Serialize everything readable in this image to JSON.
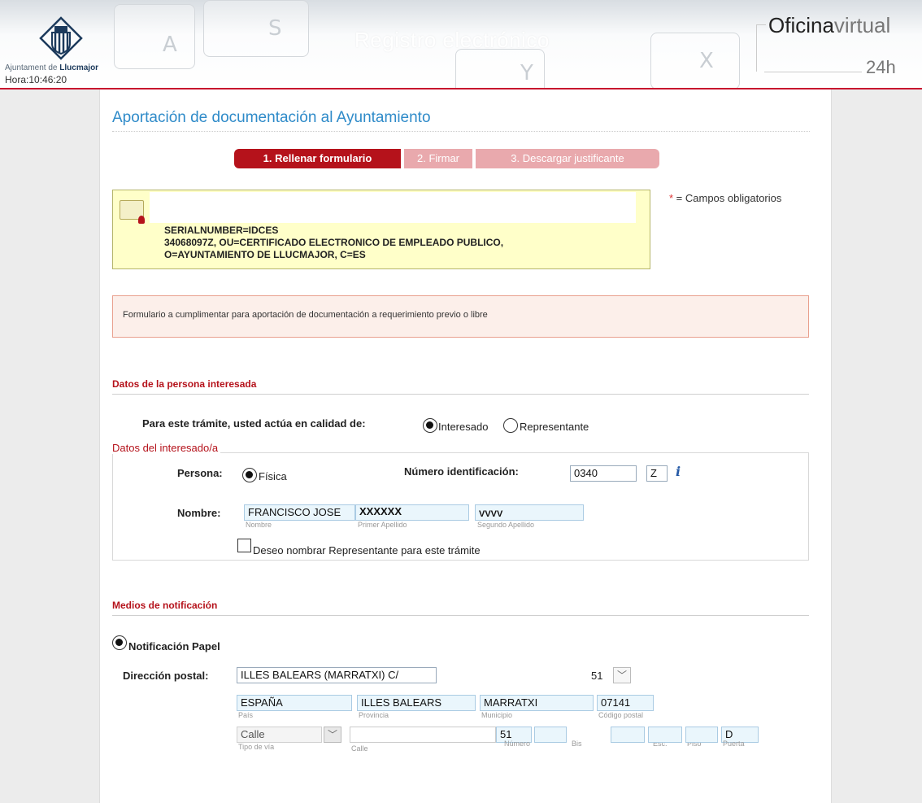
{
  "header": {
    "municipality_prefix": "Ajuntament de",
    "municipality_name": "Llucmajor",
    "clock": "Hora:10:46:20",
    "title": "Registro electrónico",
    "brand_main": "Oficina",
    "brand_suffix": "virtual",
    "brand_hours": "24h"
  },
  "page": {
    "title": "Aportación de documentación al Ayuntamiento",
    "steps": [
      "1. Rellenar formulario",
      "2. Firmar",
      "3. Descargar justificante"
    ],
    "required_star": "*",
    "required_note": " = Campos obligatorios",
    "certificate": {
      "line1": "SERIALNUMBER=IDCES",
      "line2": "34068097Z, OU=CERTIFICADO ELECTRONICO DE EMPLEADO PUBLICO,",
      "line3": "O=AYUNTAMIENTO DE LLUCMAJOR, C=ES"
    },
    "info_text": "Formulario a cumplimentar para aportación de documentación a requerimiento previo o libre"
  },
  "interesado": {
    "section_title": "Datos de la persona interesada",
    "role_question": "Para este trámite, usted actúa en calidad de:",
    "role_options": [
      "Interesado",
      "Representante"
    ],
    "fieldset_legend": "Datos del interesado/a",
    "persona_label": "Persona:",
    "persona_option": "Física",
    "id_label": "Número identificación:",
    "id_value": "0340",
    "id_letter": "Z",
    "nombre_label": "Nombre:",
    "nombre_value": "FRANCISCO JOSE",
    "primer_apellido_value": "XXXXXX",
    "segundo_apellido_value": "VVVV",
    "nombre_hint": "Nombre",
    "primer_apellido_hint": "Primer Apellido",
    "segundo_apellido_hint": "Segundo Apellido",
    "representante_checkbox": "Deseo nombrar Representante para este trámite"
  },
  "notificacion": {
    "section_title": "Medios de notificación",
    "option": "Notificación Papel",
    "address_label": "Dirección postal:",
    "address_value": "ILLES BALEARS (MARRATXI) C/",
    "address_number": "51",
    "pais": "ESPAÑA",
    "provincia": "ILLES BALEARS",
    "municipio": "MARRATXI",
    "codigo_postal": "07141",
    "pais_hint": "País",
    "provincia_hint": "Provincia",
    "municipio_hint": "Municipio",
    "cp_hint": "Código postal",
    "tipo_via": "Calle",
    "tipo_via_hint": "Tipo de vía",
    "calle_hint": "Calle",
    "numero": "51",
    "numero_hint": "Número",
    "bis_hint": "Bis",
    "esc_hint": "Esc.",
    "piso_hint": "Piso",
    "puerta": "D",
    "puerta_hint": "Puerta"
  }
}
